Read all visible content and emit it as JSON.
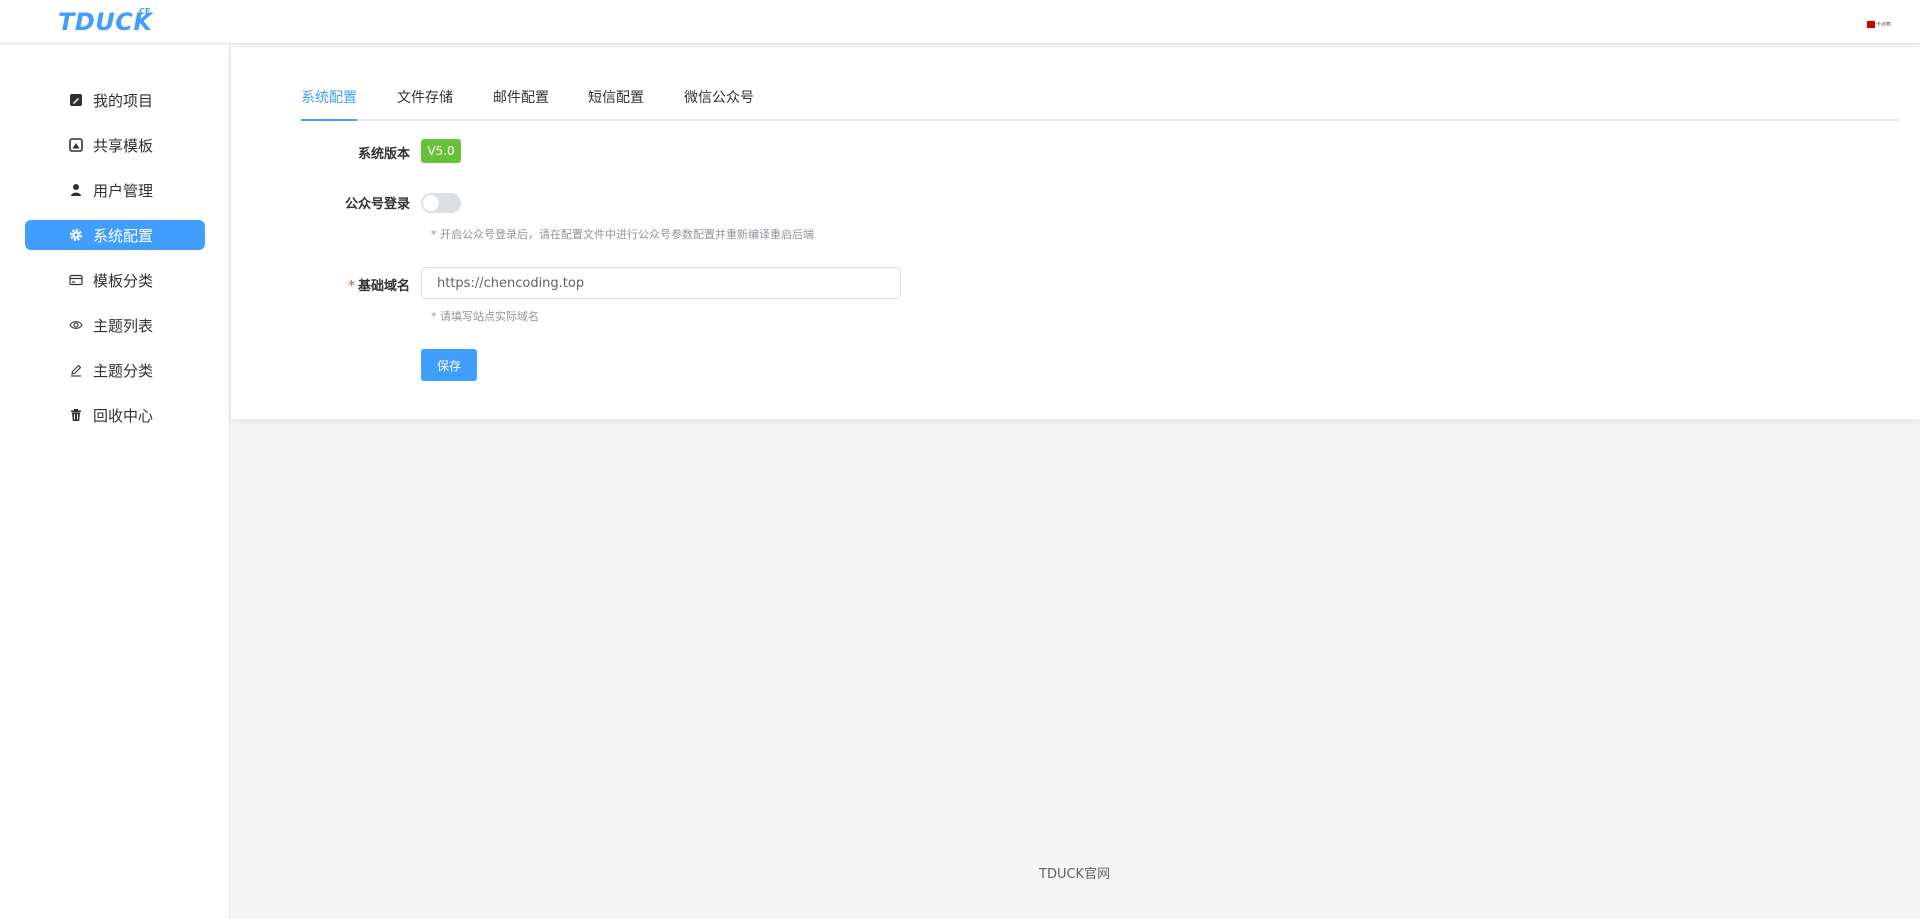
{
  "header": {
    "logo": "TDUCK",
    "logo_sup": "CE",
    "avatar_text": "卡点鸭"
  },
  "sidebar": {
    "items": [
      {
        "label": "我的项目",
        "icon": "edit-square-icon",
        "active": false
      },
      {
        "label": "共享模板",
        "icon": "picture-icon",
        "active": false
      },
      {
        "label": "用户管理",
        "icon": "user-icon",
        "active": false
      },
      {
        "label": "系统配置",
        "icon": "gear-icon",
        "active": true
      },
      {
        "label": "模板分类",
        "icon": "card-icon",
        "active": false
      },
      {
        "label": "主题列表",
        "icon": "eye-icon",
        "active": false
      },
      {
        "label": "主题分类",
        "icon": "pen-icon",
        "active": false
      },
      {
        "label": "回收中心",
        "icon": "trash-icon",
        "active": false
      }
    ]
  },
  "tabs": [
    {
      "label": "系统配置",
      "active": true
    },
    {
      "label": "文件存储",
      "active": false
    },
    {
      "label": "邮件配置",
      "active": false
    },
    {
      "label": "短信配置",
      "active": false
    },
    {
      "label": "微信公众号",
      "active": false
    }
  ],
  "form": {
    "version_label": "系统版本",
    "version_value": "V5.0",
    "wx_login_label": "公众号登录",
    "wx_login_enabled": false,
    "wx_login_hint": "* 开启公众号登录后，请在配置文件中进行公众号参数配置并重新编译重启后端",
    "domain_label": "基础域名",
    "domain_required_mark": "*",
    "domain_value": "https://chencoding.top",
    "domain_hint": "* 请填写站点实际域名",
    "save_label": "保存"
  },
  "footer": {
    "link": "TDUCK官网"
  },
  "colors": {
    "primary": "#409eff",
    "success": "#67c23a",
    "danger": "#f56c6c"
  }
}
